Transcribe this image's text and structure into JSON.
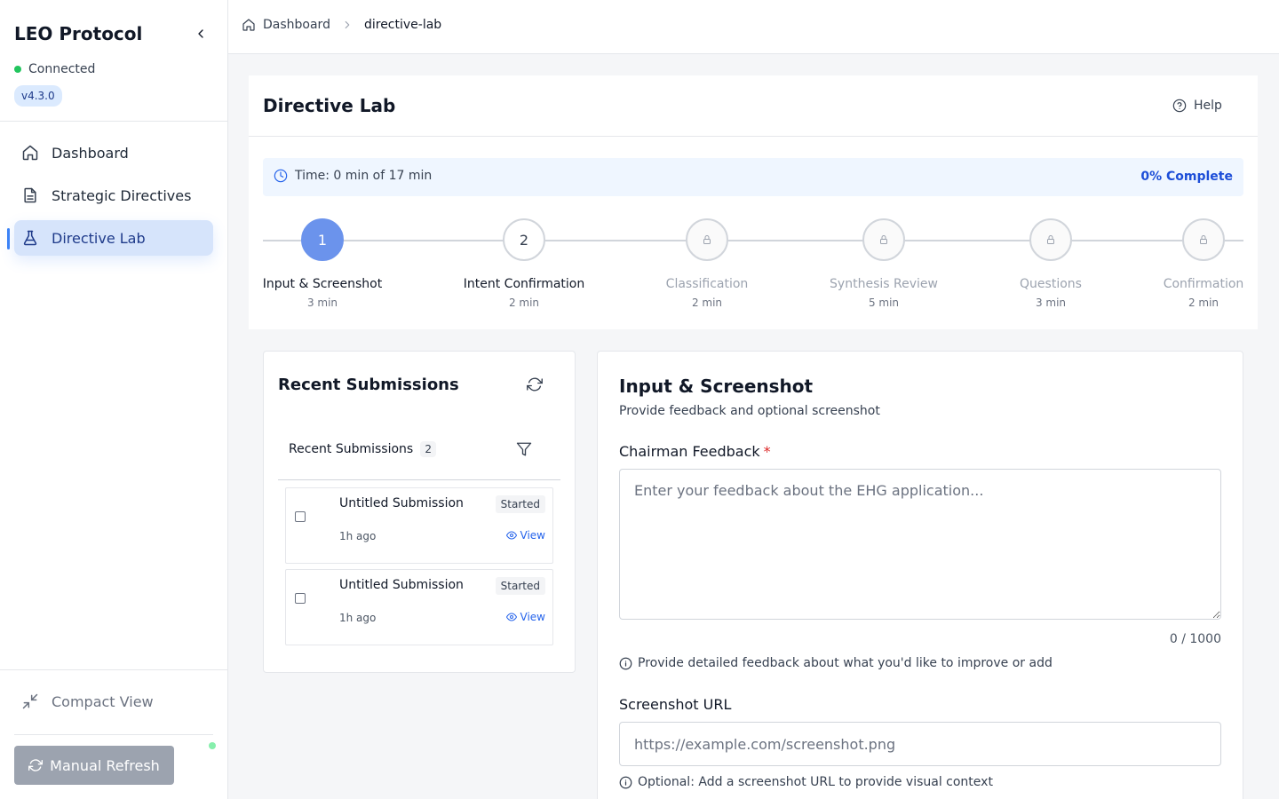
{
  "sidebar": {
    "brand": "LEO Protocol",
    "status": "Connected",
    "version": "v4.3.0",
    "nav": [
      {
        "label": "Dashboard",
        "icon": "home-icon"
      },
      {
        "label": "Strategic Directives",
        "icon": "document-icon"
      },
      {
        "label": "Directive Lab",
        "icon": "flask-icon",
        "active": true
      }
    ],
    "compact_label": "Compact View",
    "refresh_label": "Manual Refresh"
  },
  "breadcrumb": {
    "home": "Dashboard",
    "separator": ">",
    "current": "directive-lab"
  },
  "page": {
    "title": "Directive Lab",
    "help_label": "Help",
    "time_text": "Time: 0 min of 17 min",
    "percent_complete": "0% Complete"
  },
  "steps": [
    {
      "number": "1",
      "label": "Input & Screenshot",
      "time": "3 min",
      "state": "current"
    },
    {
      "number": "2",
      "label": "Intent Confirmation",
      "time": "2 min",
      "state": "available"
    },
    {
      "number": "",
      "label": "Classification",
      "time": "2 min",
      "state": "locked"
    },
    {
      "number": "",
      "label": "Synthesis Review",
      "time": "5 min",
      "state": "locked"
    },
    {
      "number": "",
      "label": "Questions",
      "time": "3 min",
      "state": "locked"
    },
    {
      "number": "",
      "label": "Confirmation",
      "time": "2 min",
      "state": "locked"
    }
  ],
  "submissions": {
    "panel_title": "Recent Submissions",
    "list_title": "Recent Submissions",
    "count": "2",
    "items": [
      {
        "title": "Untitled Submission",
        "status": "Started",
        "time": "1h ago",
        "action": "View"
      },
      {
        "title": "Untitled Submission",
        "status": "Started",
        "time": "1h ago",
        "action": "View"
      }
    ]
  },
  "form": {
    "title": "Input & Screenshot",
    "subtitle": "Provide feedback and optional screenshot",
    "feedback_label": "Chairman Feedback",
    "required_mark": "*",
    "feedback_value": "",
    "feedback_placeholder": "Enter your feedback about the EHG application...",
    "char_count": "0 / 1000",
    "feedback_hint": "Provide detailed feedback about what you'd like to improve or add",
    "url_label": "Screenshot URL",
    "url_value": "",
    "url_placeholder": "https://example.com/screenshot.png",
    "url_hint": "Optional: Add a screenshot URL to provide visual context"
  },
  "colors": {
    "accent": "#2563eb",
    "active_nav_bg": "#d6e4fb",
    "current_step": "#6b93ec",
    "connected": "#22c55e",
    "required": "#dc2626",
    "refresh_button": "#9ca3af"
  }
}
